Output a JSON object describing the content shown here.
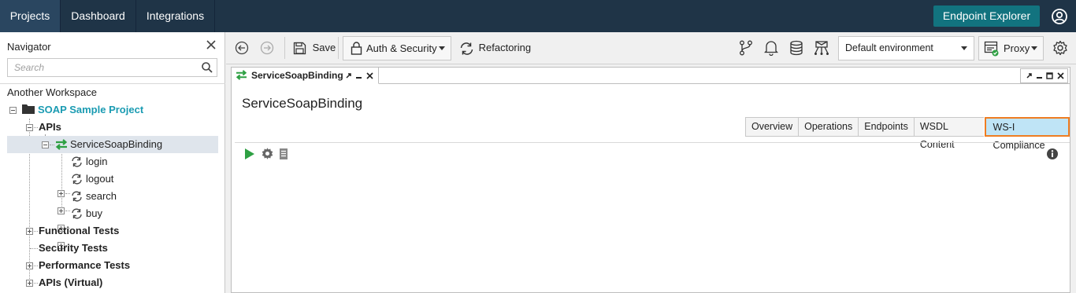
{
  "topbar": {
    "tabs": [
      {
        "label": "Projects",
        "active": true
      },
      {
        "label": "Dashboard",
        "active": false
      },
      {
        "label": "Integrations",
        "active": false
      }
    ],
    "endpoint_explorer": "Endpoint Explorer",
    "user_icon": "user-circle-icon"
  },
  "navigator": {
    "title": "Navigator",
    "search_placeholder": "Search",
    "workspace": "Another Workspace",
    "project": "SOAP Sample Project",
    "apis": "APIs",
    "binding": "ServiceSoapBinding",
    "operations": [
      "login",
      "logout",
      "search",
      "buy"
    ],
    "sections": [
      "Functional Tests",
      "Security Tests",
      "Performance Tests",
      "APIs (Virtual)"
    ]
  },
  "toolbar": {
    "save": "Save",
    "auth_security": "Auth & Security",
    "refactoring": "Refactoring",
    "environment": "Default environment",
    "proxy": "Proxy"
  },
  "editor": {
    "tab_label": "ServiceSoapBinding",
    "title": "ServiceSoapBinding",
    "subtabs": [
      "Overview",
      "Operations",
      "Endpoints",
      "WSDL Content",
      "WS-I Compliance"
    ],
    "active_subtab": "WS-I Compliance"
  },
  "colors": {
    "topbar": "#1f3447",
    "accent_teal": "#12737f",
    "project_link": "#1a9bb2",
    "highlight_border": "#ef7d22",
    "active_tab_bg": "#bfe4f6",
    "green": "#2ea043"
  }
}
